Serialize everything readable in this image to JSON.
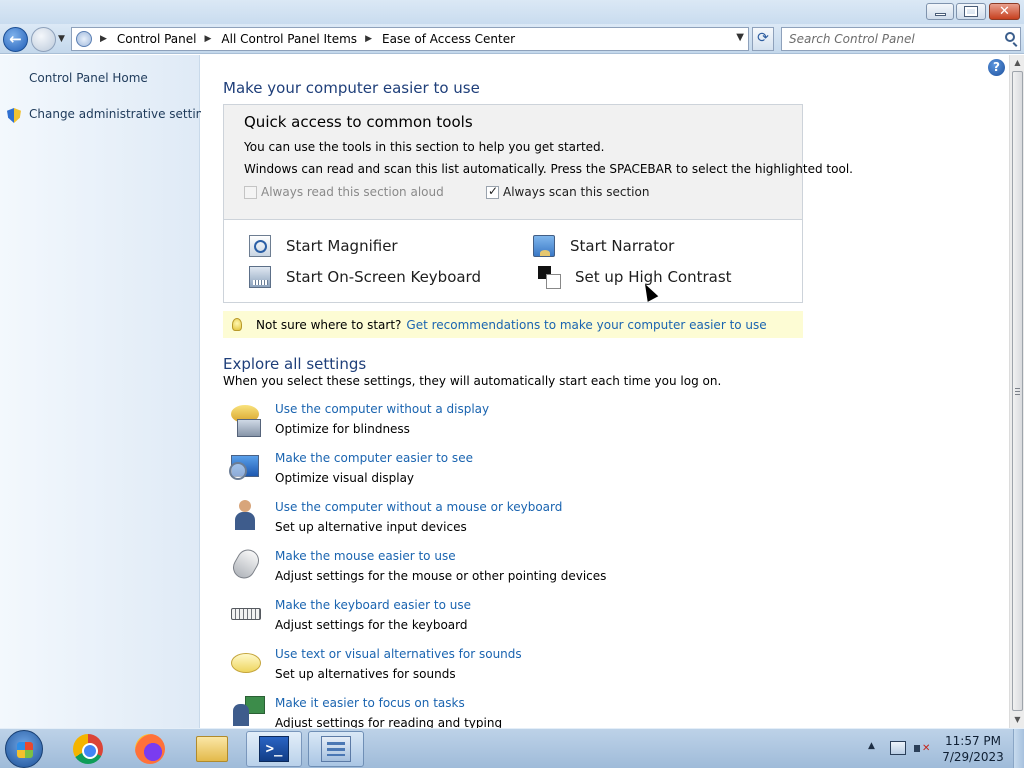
{
  "window": {
    "minimize_label": "–",
    "maximize_label": "▭",
    "close_label": "✕"
  },
  "nav": {
    "breadcrumb": [
      "Control Panel",
      "All Control Panel Items",
      "Ease of Access Center"
    ],
    "search_placeholder": "Search Control Panel",
    "refresh_symbol": "⟳"
  },
  "sidebar": {
    "items": [
      {
        "label": "Control Panel Home"
      },
      {
        "label": "Change administrative settings"
      }
    ]
  },
  "main": {
    "title": "Make your computer easier to use",
    "quick": {
      "title": "Quick access to common tools",
      "line1": "You can use the tools in this section to help you get started.",
      "line2": "Windows can read and scan this list automatically.  Press the SPACEBAR to select the highlighted tool.",
      "read_aloud": {
        "label": "Always read this section aloud",
        "checked": false,
        "enabled": false
      },
      "scan": {
        "label": "Always scan this section",
        "checked": true,
        "enabled": true
      },
      "tools": [
        {
          "label": "Start Magnifier",
          "icon": "magnifier-icon"
        },
        {
          "label": "Start Narrator",
          "icon": "narrator-icon"
        },
        {
          "label": "Start On-Screen Keyboard",
          "icon": "keyboard-icon"
        },
        {
          "label": "Set up High Contrast",
          "icon": "high-contrast-icon"
        }
      ]
    },
    "tip": {
      "text": "Not sure where to start?",
      "link": "Get recommendations to make your computer easier to use"
    },
    "explore": {
      "title": "Explore all settings",
      "subtitle": "When you select these settings, they will automatically start each time you log on.",
      "items": [
        {
          "link": "Use the computer without a display",
          "desc": "Optimize for blindness",
          "icon": "display-speech-icon"
        },
        {
          "link": "Make the computer easier to see",
          "desc": "Optimize visual display",
          "icon": "monitor-magnifier-icon"
        },
        {
          "link": "Use the computer without a mouse or keyboard",
          "desc": "Set up alternative input devices",
          "icon": "person-icon"
        },
        {
          "link": "Make the mouse easier to use",
          "desc": "Adjust settings for the mouse or other pointing devices",
          "icon": "mouse-icon"
        },
        {
          "link": "Make the keyboard easier to use",
          "desc": "Adjust settings for the keyboard",
          "icon": "keyboard-icon"
        },
        {
          "link": "Use text or visual alternatives for sounds",
          "desc": "Set up alternatives for sounds",
          "icon": "speech-bubble-icon"
        },
        {
          "link": "Make it easier to focus on tasks",
          "desc": "Adjust settings for reading and typing",
          "icon": "focus-icon"
        }
      ]
    }
  },
  "help_symbol": "?",
  "taskbar": {
    "apps": [
      {
        "name": "chrome-icon"
      },
      {
        "name": "firefox-icon"
      },
      {
        "name": "explorer-folder-icon"
      },
      {
        "name": "powershell-icon",
        "glyph": ">_"
      },
      {
        "name": "control-panel-icon"
      }
    ],
    "time": "11:57 PM",
    "date": "7/29/2023"
  }
}
